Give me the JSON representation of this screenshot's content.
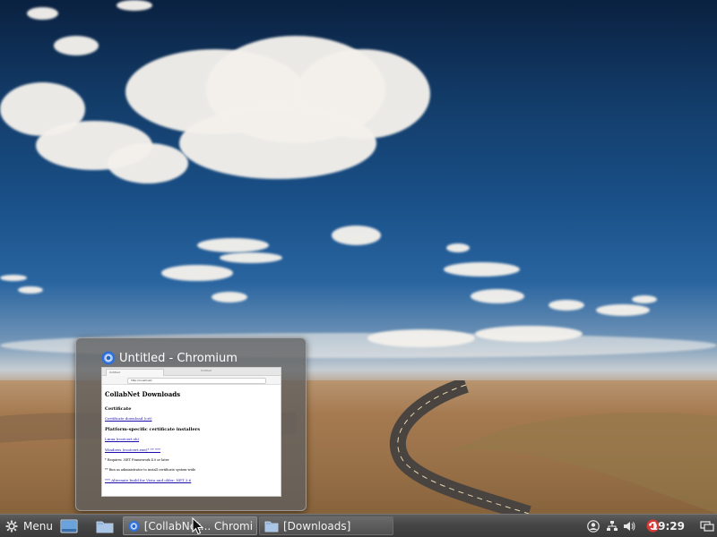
{
  "preview": {
    "title": "Untitled - Chromium",
    "thumbnail": {
      "tab_label": "Untitled",
      "address": "http://localhost/",
      "page_heading": "CollabNet Downloads",
      "section_certificate": "Certificate",
      "link_certificate": "Certificate download (crt)",
      "section_platform": "Platform-specific certificate installers",
      "link_linux": "Linux (rootcert.sh)",
      "link_windows": "Windows (rootcert.exe)* ** ***",
      "note_1": "* Requires .NET Framework 4.0 or later",
      "note_2": "** Run as administrator to install certificate system-wide",
      "note_3": "*** Alternate build for Vista and older: NET 3.6"
    }
  },
  "taskbar": {
    "menu_label": "Menu",
    "tasks": [
      {
        "label": "[CollabNet... Chromi..."
      },
      {
        "label": "[Downloads]"
      }
    ],
    "clock": "19:29"
  },
  "colors": {
    "taskbar_bg": "#454545",
    "accent_red": "#d83a36",
    "chromium_blue": "#4c8bf5"
  },
  "icons": {
    "menu": "linux-mint-icon",
    "show_desktop": "show-desktop-icon",
    "files": "folder-icon",
    "chromium": "chromium-icon",
    "user": "user-icon",
    "network": "network-icon",
    "volume": "volume-icon",
    "update": "update-manager-icon",
    "workspace": "workspace-switcher-icon"
  }
}
